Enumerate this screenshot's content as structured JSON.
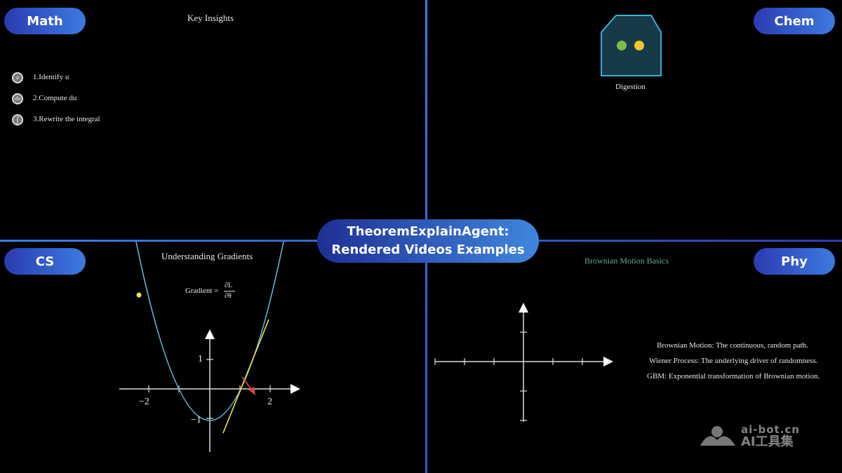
{
  "center": {
    "line1": "TheoremExplainAgent:",
    "line2": "Rendered Videos Examples"
  },
  "math": {
    "badge": "Math",
    "title": "Key Insights",
    "steps": [
      {
        "icon": "u",
        "label": "1.Identify u"
      },
      {
        "icon": "du",
        "label": "2.Compute du"
      },
      {
        "icon": "∫",
        "label": "3.Rewrite the integral"
      }
    ]
  },
  "chem": {
    "badge": "Chem",
    "caption": "Digestion"
  },
  "cs": {
    "badge": "CS",
    "title": "Understanding Gradients",
    "formula_prefix": "Gradient =",
    "formula_num": "∂L",
    "formula_den": "∂θ",
    "ticks": {
      "xneg": "−2",
      "xpos": "2",
      "ypos": "1",
      "yneg": "−1"
    }
  },
  "phy": {
    "badge": "Phy",
    "title": "Brownian Motion Basics",
    "notes": [
      "Brownian Motion: The continuous, random path.",
      "Wiener Process: The underlying driver of randomness.",
      "GBM: Exponential transformation of Brownian motion."
    ]
  },
  "watermark": {
    "line1": "ai-bot.cn",
    "line2": "AI工具集"
  },
  "colors": {
    "accent": "#3a7ee8",
    "curve": "#5fb2d8",
    "tangent": "#f0e442",
    "arrow": "#e04848",
    "chem_green": "#7dbb4e",
    "chem_yellow": "#f3c52e",
    "phy_title": "#5fae98"
  }
}
